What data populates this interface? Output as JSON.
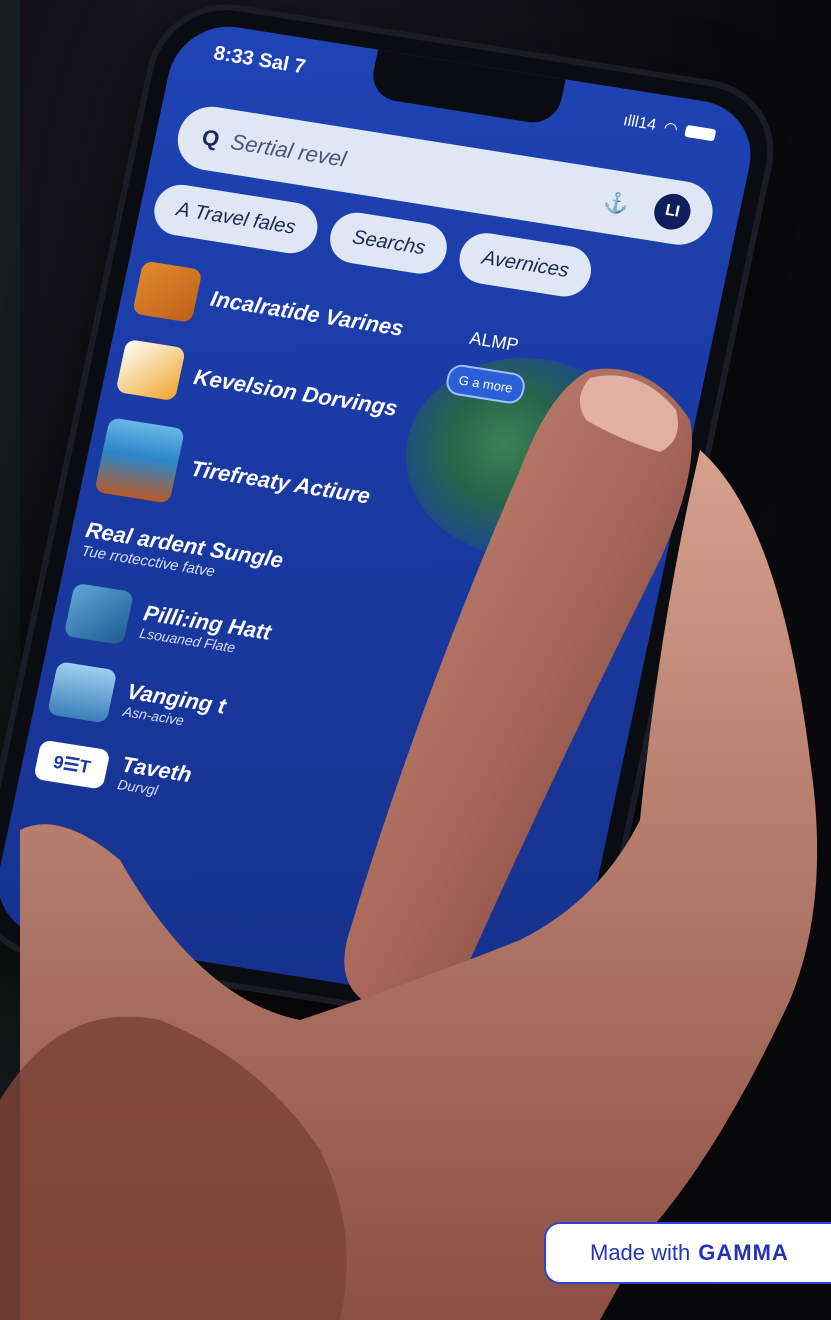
{
  "status": {
    "time": "8:33 Sal 7",
    "signal": "ılll14"
  },
  "search": {
    "icon": "search-icon",
    "placeholder": "Sertial revel",
    "avatar_letter": "LI"
  },
  "chips": [
    "A Travel fales",
    "Searchs",
    "Avernices"
  ],
  "map": {
    "label": "ALMP",
    "pill": "G a more"
  },
  "items": [
    {
      "title": "Incalratide Varines",
      "thumb": "car-thumbnail"
    },
    {
      "title": "Kevelsion Dorvings",
      "thumb": "tent-thumbnail"
    },
    {
      "title": "Tirefreaty Actiure",
      "thumb": "beach-thumbnail"
    }
  ],
  "section": {
    "title": "Real ardent Sungle",
    "subtitle": "Tue rrotecctive fatve"
  },
  "items2": [
    {
      "title": "Pilli:ing Hatt",
      "subtitle": "Lsouaned Flate",
      "thumb": "van-thumbnail"
    },
    {
      "title": "Vanging t",
      "subtitle": "Asn-acive",
      "thumb": "city-thumbnail"
    },
    {
      "title": "Taveth",
      "subtitle": "Durvgl",
      "thumb_text": "9☰T"
    }
  ],
  "nav": {
    "icon": "triangle-icon"
  },
  "badge": {
    "prefix": "Made with",
    "brand": "GAMMA"
  }
}
